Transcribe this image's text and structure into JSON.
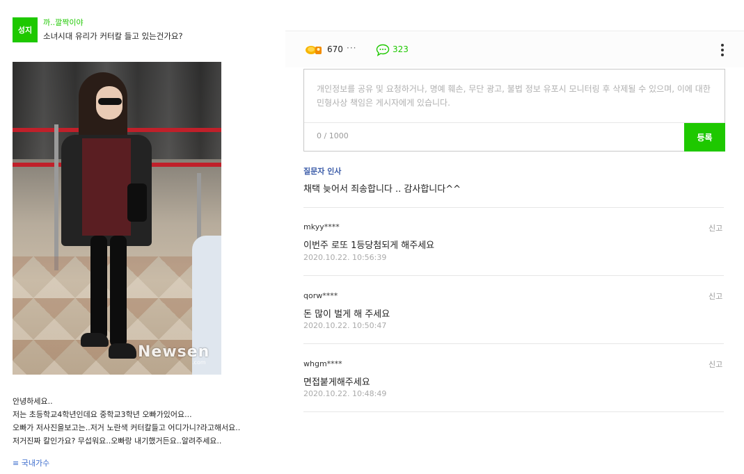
{
  "question": {
    "badge": "성지",
    "author": "까..깔짝이야",
    "title": "소녀시대 유리가 커터칼 들고 있는건가요?",
    "image_watermark": "Newsen",
    "image_watermark_sub": ".com",
    "body_lines": [
      "안녕하세요..",
      "저는 초등학교4학년인데요 중학교3학년 오빠가있어요...",
      "오빠가 저사진을보고는..저거 노란색 커터칼들고 어디가니?라고해서요..",
      "저거진짜 칼인가요? 무섭워요..오빠랑 내기했거든요..알려주세요.."
    ],
    "category": "≡ 국내가수"
  },
  "stats": {
    "like_count": "670",
    "dots": "···",
    "comment_count": "323"
  },
  "comment_form": {
    "placeholder": "개인정보를 공유 및 요청하거나, 명예 훼손, 무단 광고, 불법 정보 유포시 모니터링 후 삭제될 수 있으며, 이에 대한 민형사상 책임은 게시자에게 있습니다.",
    "char_count": "0 / 1000",
    "submit_label": "등록"
  },
  "greeting": {
    "label": "질문자 인사",
    "text": "채택 늦어서 죄송합니다 .. 감사합니다^^"
  },
  "replies": [
    {
      "user": "mkyy****",
      "text": "이번주 로또 1등당첨되게 해주세요",
      "date": "2020.10.22. 10:56:39",
      "report": "신고"
    },
    {
      "user": "qorw****",
      "text": "돈 많이 벌게 해 주세요",
      "date": "2020.10.22. 10:50:47",
      "report": "신고"
    },
    {
      "user": "whgm****",
      "text": "면접붙게해주세요",
      "date": "2020.10.22. 10:48:49",
      "report": "신고"
    }
  ],
  "colors": {
    "accent_green": "#1ec800",
    "link_blue": "#3a6bcc",
    "greeting_blue": "#3a5ba8"
  }
}
